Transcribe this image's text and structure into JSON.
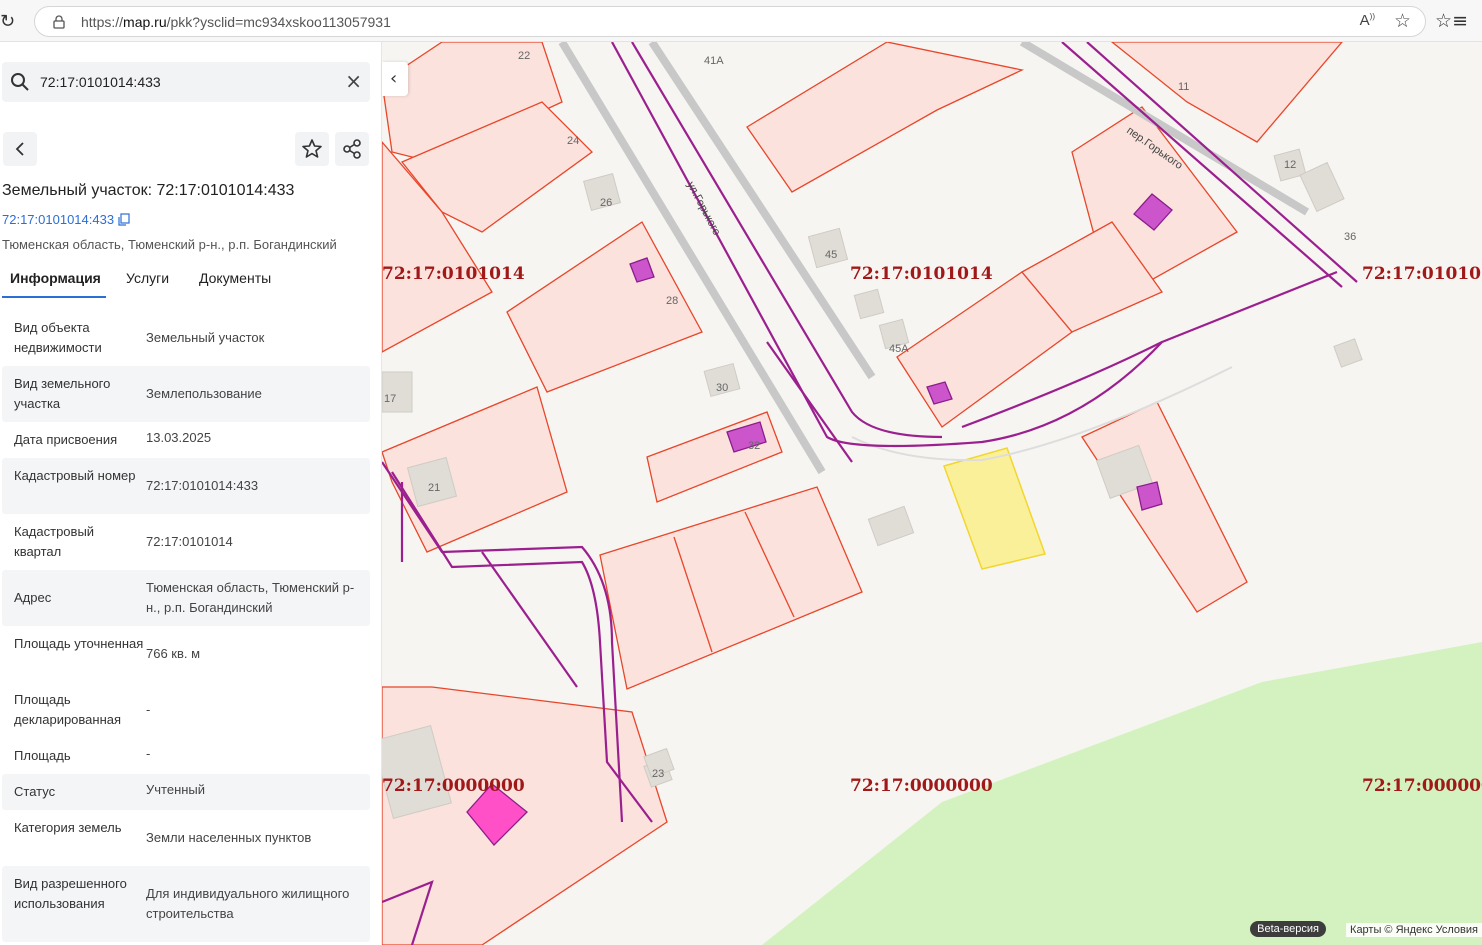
{
  "browser": {
    "url_prefix": "https://",
    "url_host": "map.ru",
    "url_path": "/pkk?ysclid=mc934xskoo113057931"
  },
  "search": {
    "value": "72:17:0101014:433"
  },
  "object": {
    "title": "Земельный участок: 72:17:0101014:433",
    "cadastral_link": "72:17:0101014:433",
    "address_line": "Тюменская область, Тюменский р-н., р.п. Богандинский"
  },
  "tabs": [
    {
      "label": "Информация",
      "active": true
    },
    {
      "label": "Услуги",
      "active": false
    },
    {
      "label": "Документы",
      "active": false
    }
  ],
  "properties": [
    {
      "key": "Вид объекта недвижимости",
      "value": "Земельный участок"
    },
    {
      "key": "Вид земельного участка",
      "value": "Землепользование"
    },
    {
      "key": "Дата присвоения",
      "value": "13.03.2025"
    },
    {
      "key": "Кадастровый номер",
      "value": "72:17:0101014:433"
    },
    {
      "key": "Кадастровый квартал",
      "value": "72:17:0101014"
    },
    {
      "key": "Адрес",
      "value": "Тюменская область, Тюменский р-н., р.п. Богандинский"
    },
    {
      "key": "Площадь уточненная",
      "value": "766 кв. м"
    },
    {
      "key": "Площадь декларированная",
      "value": "-"
    },
    {
      "key": "Площадь",
      "value": "-"
    },
    {
      "key": "Статус",
      "value": "Учтенный"
    },
    {
      "key": "Категория земель",
      "value": "Земли населенных пунктов"
    },
    {
      "key": "Вид разрешенного использования",
      "value": "Для индивидуального жилищного строительства"
    }
  ],
  "map": {
    "quarter_labels": [
      "72:17:0101014",
      "72:17:0101014",
      "72:17:010101",
      "72:17:0000000",
      "72:17:0000000",
      "72:17:000000"
    ],
    "house_numbers": [
      "22",
      "41А",
      "11",
      "24",
      "12",
      "26",
      "45",
      "36",
      "28",
      "45А",
      "30",
      "17",
      "32",
      "21",
      "23"
    ],
    "streets": [
      "ул.Горького",
      "пер.Горького"
    ],
    "beta_label": "Beta-версия",
    "copyright": "Карты © Яндекс   Условия"
  },
  "colors": {
    "parcel_fill": "#fbe2dd",
    "parcel_stroke": "#e8462a",
    "selected_fill": "#fbf09a",
    "selected_stroke": "#f2d630",
    "utility_line": "#9b1f8f",
    "building_mark": "#cc55cc",
    "quarter_label": "#a01818",
    "forest": "#d4f2c0",
    "accent": "#2b6ed6"
  },
  "icons": [
    "reload-icon",
    "lock-icon",
    "read-aloud-icon",
    "star-icon",
    "favorites-icon",
    "search-icon",
    "close-icon",
    "chevron-left-icon",
    "star-outline-icon",
    "share-icon",
    "copy-icon"
  ]
}
